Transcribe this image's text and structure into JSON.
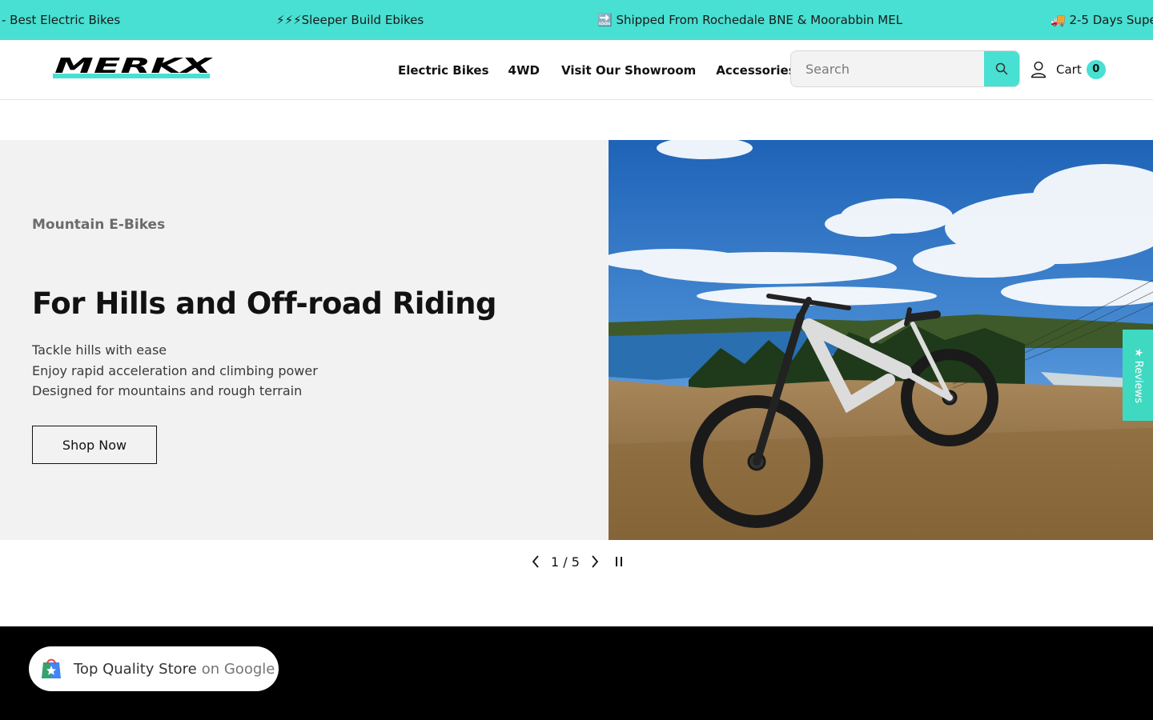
{
  "announcement": {
    "items": [
      "- Best Electric Bikes",
      "⚡⚡⚡Sleeper Build Ebikes",
      "🔜 Shipped From Rochedale BNE & Moorabbin MEL",
      "🚚 2-5 Days Supe"
    ],
    "background": "#48e0d2"
  },
  "header": {
    "logo_text": "MERKX",
    "nav": [
      "Electric Bikes",
      "4WD",
      "Visit Our Showroom",
      "Accessories"
    ],
    "search_placeholder": "Search",
    "cart_label": "Cart",
    "cart_count": "0",
    "accent_color": "#48e0d2"
  },
  "hero": {
    "eyebrow": "Mountain E-Bikes",
    "title": "For Hills and Off-road Riding",
    "lines": [
      "Tackle hills with ease",
      "Enjoy rapid acceleration and climbing power",
      "Designed for mountains and rough terrain"
    ],
    "button_label": "Shop Now"
  },
  "slider": {
    "current": "1",
    "separator": "/",
    "total": "5"
  },
  "reviews_tab": {
    "label": "★ Reviews"
  },
  "google_badge": {
    "text_main": "Top Quality Store",
    "text_secondary": "on Google"
  }
}
